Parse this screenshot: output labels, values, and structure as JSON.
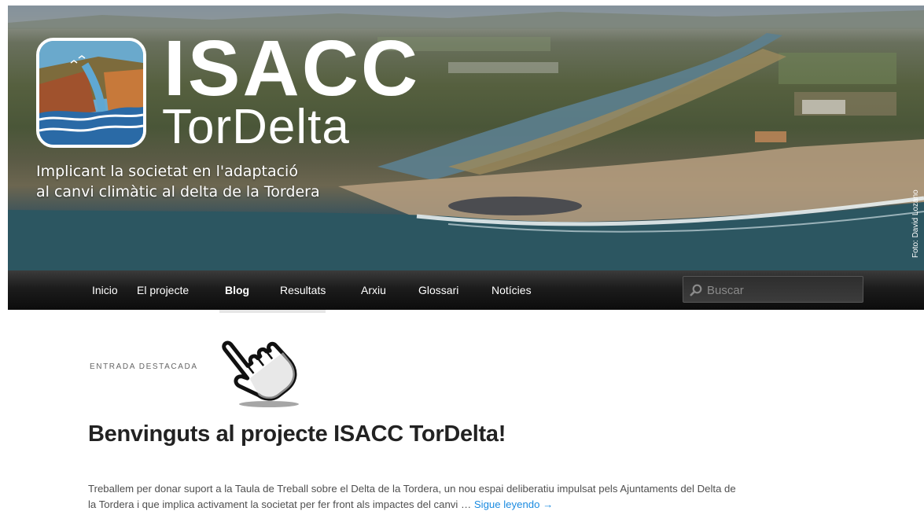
{
  "header": {
    "brand_top": "ISACC",
    "brand_bottom": "TorDelta",
    "tagline_line1": "Implicant la societat en l'adaptació",
    "tagline_line2": "al canvi climàtic al delta de la Tordera",
    "photo_credit": "Foto: David Lozano"
  },
  "nav": {
    "items": [
      {
        "label": "Inicio"
      },
      {
        "label": "El projecte"
      },
      {
        "label": "Blog"
      },
      {
        "label": "Resultats"
      },
      {
        "label": "Arxiu"
      },
      {
        "label": "Glossari"
      },
      {
        "label": "Notícies"
      }
    ],
    "active": "Blog",
    "search_placeholder": "Buscar"
  },
  "post": {
    "featured_label": "ENTRADA DESTACADA",
    "title": "Benvinguts al projecte ISACC TorDelta!",
    "excerpt_line1": "Treballem per donar suport a la Taula de Treball sobre el Delta de la Tordera, un nou espai deliberatiu impulsat pels Ajuntaments del Delta de",
    "excerpt_line2": "la Tordera  i que implica activament la societat per fer front als impactes del canvi … ",
    "read_more": "Sigue leyendo →"
  },
  "colors": {
    "nav_background": "#111111",
    "link_blue": "#1b8be0",
    "title_text": "#222222",
    "body_text": "#4f4f4f"
  },
  "icons": [
    "search-icon",
    "hand-pointer-icon",
    "logo-emblem-icon"
  ]
}
